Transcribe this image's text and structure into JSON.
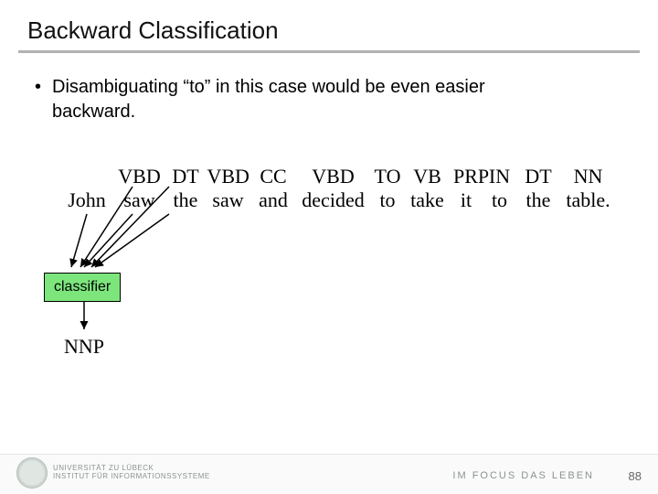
{
  "title": "Backward Classification",
  "bullet": "Disambiguating “to” in this case would be even easier backward.",
  "tags": [
    "",
    "VBD",
    "DT",
    "VBD",
    "CC",
    "VBD",
    "TO",
    "VB",
    "PRP",
    "IN",
    "DT",
    "NN"
  ],
  "words": [
    "John",
    "saw",
    "the",
    "saw",
    "and",
    "decided",
    "to",
    "take",
    "it",
    "to",
    "the",
    "table."
  ],
  "classifier_label": "classifier",
  "output_tag": "NNP",
  "footer": {
    "university_line1": "UNIVERSITÄT ZU LÜBECK",
    "university_line2": "INSTITUT FÜR INFORMATIONSSYSTEME",
    "motto": "IM FOCUS DAS LEBEN",
    "page": "88"
  }
}
